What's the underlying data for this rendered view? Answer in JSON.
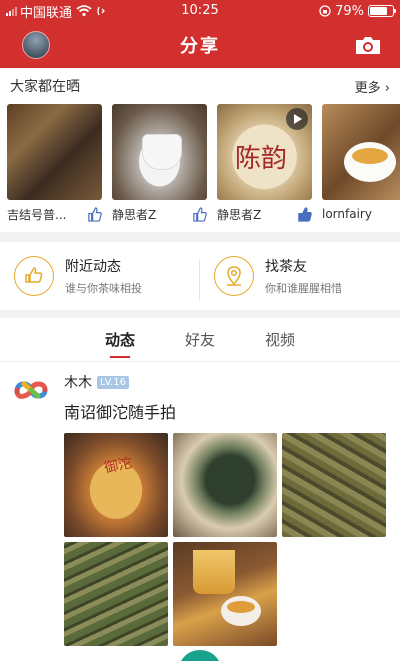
{
  "status": {
    "carrier": "中国联通",
    "time": "10:25",
    "battery": "79%",
    "battery_level": 0.79
  },
  "header": {
    "title": "分享",
    "left_icon": "user-avatar",
    "right_icon": "camera-icon"
  },
  "sharing": {
    "title": "大家都在晒",
    "more": "更多",
    "items": [
      {
        "name": "吉结号普...",
        "liked": false
      },
      {
        "name": "静思者Z",
        "liked": false
      },
      {
        "name": "静思者Z",
        "liked": true
      },
      {
        "name": "lornfairy",
        "liked": false
      }
    ]
  },
  "features": [
    {
      "title": "附近动态",
      "subtitle": "谁与你茶味相投",
      "icon": "thumbs-up-icon"
    },
    {
      "title": "找茶友",
      "subtitle": "你和谁腥腥相惜",
      "icon": "location-pin-icon"
    }
  ],
  "tabs": [
    {
      "label": "动态",
      "active": true
    },
    {
      "label": "好友",
      "active": false
    },
    {
      "label": "视频",
      "active": false
    }
  ],
  "post": {
    "author": "木木",
    "level": "LV.16",
    "text": "南诏御沱随手拍",
    "image_count": 5,
    "image1_label": "御沱"
  },
  "colors": {
    "brand": "#d2302f",
    "accent_gold": "#e5a92a",
    "thumb_active": "#4a6fbf"
  }
}
